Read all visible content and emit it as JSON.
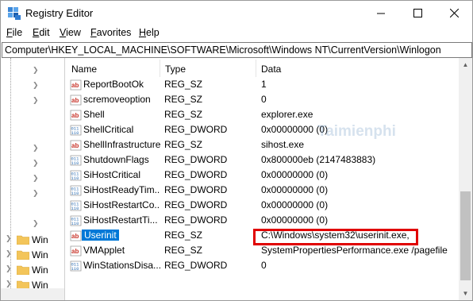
{
  "window": {
    "title": "Registry Editor",
    "controls": {
      "minimize": "minimize",
      "maximize": "maximize",
      "close": "close"
    }
  },
  "menu": [
    {
      "accel": "F",
      "rest": "ile"
    },
    {
      "accel": "E",
      "rest": "dit"
    },
    {
      "accel": "V",
      "rest": "iew"
    },
    {
      "accel": "F",
      "rest": "avorites"
    },
    {
      "accel": "H",
      "rest": "elp"
    }
  ],
  "address": "Computer\\HKEY_LOCAL_MACHINE\\SOFTWARE\\Microsoft\\Windows NT\\CurrentVersion\\Winlogon",
  "tree": {
    "items": [
      {
        "label": "Win"
      },
      {
        "label": "Win"
      },
      {
        "label": "Win"
      },
      {
        "label": "Win"
      }
    ]
  },
  "columns": {
    "name": "Name",
    "type": "Type",
    "data": "Data"
  },
  "rows": [
    {
      "icon": "string-value-icon",
      "name": "ReportBootOk",
      "type": "REG_SZ",
      "data": "1"
    },
    {
      "icon": "string-value-icon",
      "name": "scremoveoption",
      "type": "REG_SZ",
      "data": "0"
    },
    {
      "icon": "string-value-icon",
      "name": "Shell",
      "type": "REG_SZ",
      "data": "explorer.exe"
    },
    {
      "icon": "binary-value-icon",
      "name": "ShellCritical",
      "type": "REG_DWORD",
      "data": "0x00000000 (0)"
    },
    {
      "icon": "string-value-icon",
      "name": "ShellInfrastructure",
      "type": "REG_SZ",
      "data": "sihost.exe"
    },
    {
      "icon": "binary-value-icon",
      "name": "ShutdownFlags",
      "type": "REG_DWORD",
      "data": "0x800000eb (2147483883)"
    },
    {
      "icon": "binary-value-icon",
      "name": "SiHostCritical",
      "type": "REG_DWORD",
      "data": "0x00000000 (0)"
    },
    {
      "icon": "binary-value-icon",
      "name": "SiHostReadyTim...",
      "type": "REG_DWORD",
      "data": "0x00000000 (0)"
    },
    {
      "icon": "binary-value-icon",
      "name": "SiHostRestartCo...",
      "type": "REG_DWORD",
      "data": "0x00000000 (0)"
    },
    {
      "icon": "binary-value-icon",
      "name": "SiHostRestartTi...",
      "type": "REG_DWORD",
      "data": "0x00000000 (0)"
    },
    {
      "icon": "string-value-icon",
      "name": "Userinit",
      "type": "REG_SZ",
      "data": "C:\\Windows\\system32\\userinit.exe,",
      "selected": true
    },
    {
      "icon": "string-value-icon",
      "name": "VMApplet",
      "type": "REG_SZ",
      "data": "SystemPropertiesPerformance.exe /pagefile"
    },
    {
      "icon": "binary-value-icon",
      "name": "WinStationsDisa...",
      "type": "REG_DWORD",
      "data": "0"
    }
  ],
  "colors": {
    "selection": "#0078d7",
    "highlight_box": "#e00000",
    "string_icon": "#c8342a",
    "binary_icon": "#2f6fb4"
  },
  "watermark": "Taimienphi"
}
